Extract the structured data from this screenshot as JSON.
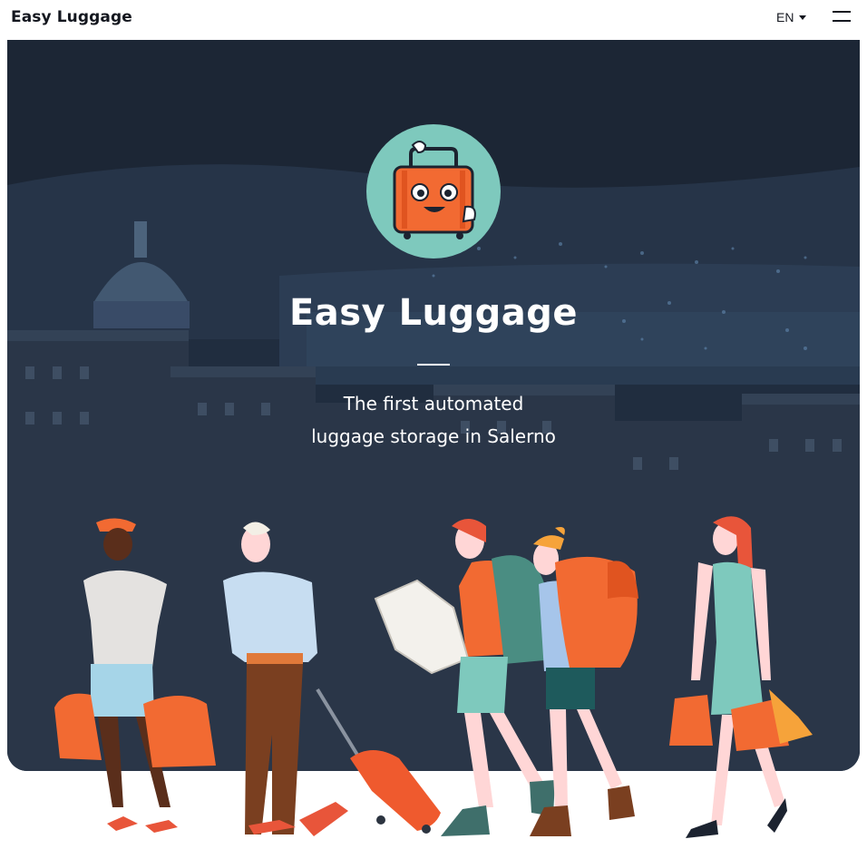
{
  "header": {
    "brand": "Easy Luggage",
    "language": "EN",
    "menu_icon": "hamburger-menu-icon"
  },
  "hero": {
    "title": "Easy Luggage",
    "tagline_line1": "The first automated",
    "tagline_line2": "luggage storage in Salerno",
    "logo_icon": "smiling-suitcase-mascot",
    "background": "salerno-night-cityscape",
    "illustration": "travelers-with-luggage"
  },
  "colors": {
    "accent_orange": "#f26a32",
    "logo_teal": "#7ec9bd",
    "text_dark": "#14171f",
    "overlay_navy": "#2b3a4f"
  }
}
